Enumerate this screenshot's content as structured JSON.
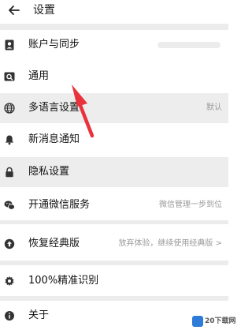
{
  "header": {
    "title": "设置"
  },
  "rows": [
    {
      "label": "账户与同步",
      "value": "",
      "icon": "account-icon"
    },
    {
      "label": "通用",
      "value": "",
      "icon": "general-icon"
    },
    {
      "label": "多语言设置",
      "value": "默认",
      "icon": "globe-icon"
    },
    {
      "label": "新消息通知",
      "value": "",
      "icon": "bell-icon"
    },
    {
      "label": "隐私设置",
      "value": "",
      "icon": "lock-icon"
    },
    {
      "label": "开通微信服务",
      "value": "微信管理一步到位",
      "icon": "wechat-icon"
    },
    {
      "label": "恢复经典版",
      "value": "放弃体验，继续使用经典版 >",
      "icon": "restore-icon"
    },
    {
      "label": "100%精准识别",
      "value": "",
      "icon": "recognize-icon"
    },
    {
      "label": "关于",
      "value": "",
      "icon": "info-icon"
    }
  ],
  "colors": {
    "annotation_arrow": "#e8323c",
    "row_highlight": "#ededed",
    "separator": "#ececec"
  },
  "watermark": {
    "text": "20下载网"
  }
}
